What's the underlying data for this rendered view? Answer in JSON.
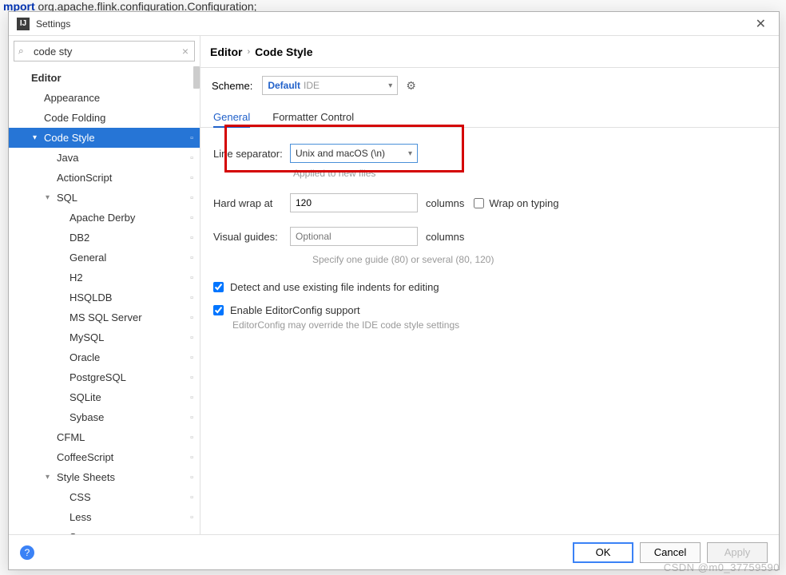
{
  "background_code_line_prefix": "mport",
  "background_code_line_rest": " org.apache.flink.configuration.Configuration;",
  "dialog": {
    "title": "Settings"
  },
  "search": {
    "value": "code sty"
  },
  "sidebar": {
    "groups": {
      "editor": "Editor",
      "appearance": "Appearance",
      "codeFolding": "Code Folding",
      "codeStyle": "Code Style",
      "java": "Java",
      "actionscript": "ActionScript",
      "sql": "SQL",
      "apacheDerby": "Apache Derby",
      "db2": "DB2",
      "general": "General",
      "h2": "H2",
      "hsqldb": "HSQLDB",
      "mssql": "MS SQL Server",
      "mysql": "MySQL",
      "oracle": "Oracle",
      "postgresql": "PostgreSQL",
      "sqlite": "SQLite",
      "sybase": "Sybase",
      "cfml": "CFML",
      "coffeescript": "CoffeeScript",
      "stylesheets": "Style Sheets",
      "css": "CSS",
      "less": "Less",
      "sass": "Sass"
    }
  },
  "breadcrumb": {
    "root": "Editor",
    "leaf": "Code Style"
  },
  "scheme": {
    "label": "Scheme:",
    "name": "Default",
    "scope": "IDE"
  },
  "tabs": {
    "general": "General",
    "formatter": "Formatter Control"
  },
  "form": {
    "lineSeparatorLabel": "Line separator:",
    "lineSeparatorValue": "Unix and macOS (\\n)",
    "appliedHint": "Applied to new files",
    "hardWrapLabel": "Hard wrap at",
    "hardWrapValue": "120",
    "columnsUnit": "columns",
    "wrapOnTyping": "Wrap on typing",
    "visualGuidesLabel": "Visual guides:",
    "visualGuidesPlaceholder": "Optional",
    "visualGuidesHint": "Specify one guide (80) or several (80, 120)",
    "detectIndents": "Detect and use existing file indents for editing",
    "enableEditorConfig": "Enable EditorConfig support",
    "editorConfigHint": "EditorConfig may override the IDE code style settings"
  },
  "footer": {
    "ok": "OK",
    "cancel": "Cancel",
    "apply": "Apply"
  },
  "watermark": "CSDN @m0_37759590"
}
